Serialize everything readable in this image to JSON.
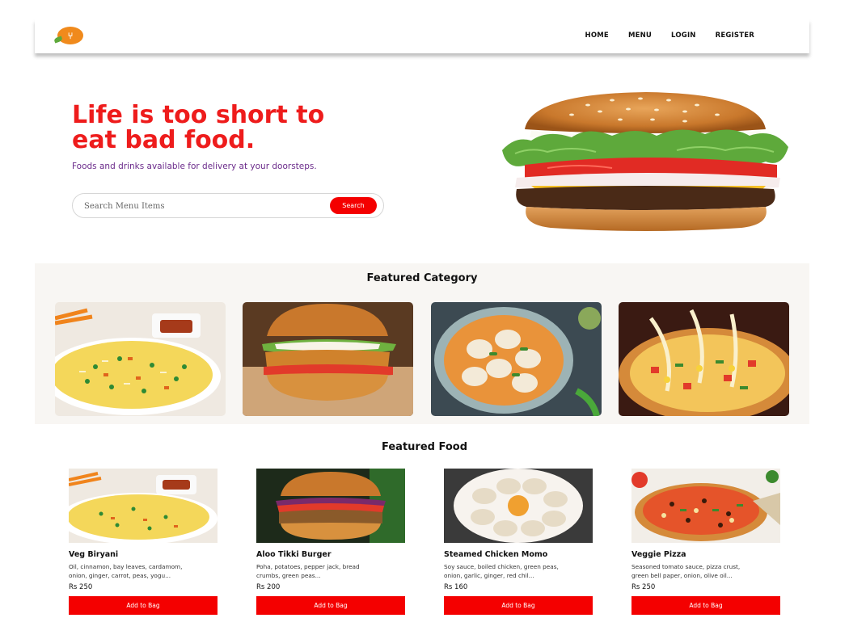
{
  "nav": {
    "items": [
      "HOME",
      "MENU",
      "LOGIN",
      "REGISTER"
    ]
  },
  "hero": {
    "title_line1": "Life is too short to",
    "title_line2": "eat bad food.",
    "subtitle": "Foods and drinks available for delivery at your doorsteps.",
    "search_placeholder": "Search Menu Items",
    "search_button": "Search"
  },
  "featured_category": {
    "title": "Featured Category",
    "items": [
      "biryani",
      "burger",
      "momo",
      "pizza"
    ]
  },
  "featured_food": {
    "title": "Featured Food",
    "items": [
      {
        "name": "Veg Biryani",
        "desc_line1": "Oil, cinnamon, bay leaves, cardamom,",
        "desc_line2": "onion, ginger, carrot, peas, yogu...",
        "price": "Rs 250",
        "button": "Add to Bag"
      },
      {
        "name": "Aloo Tikki Burger",
        "desc_line1": "Poha, potatoes, pepper jack, bread",
        "desc_line2": "crumbs, green peas...",
        "price": "Rs 200",
        "button": "Add to Bag"
      },
      {
        "name": "Steamed Chicken Momo",
        "desc_line1": "Soy sauce, boiled chicken, green peas,",
        "desc_line2": "onion, garlic, ginger, red chil...",
        "price": "Rs 160",
        "button": "Add to Bag"
      },
      {
        "name": "Veggie Pizza",
        "desc_line1": "Seasoned tomato sauce, pizza crust,",
        "desc_line2": "green bell paper, onion, olive oil...",
        "price": "Rs 250",
        "button": "Add to Bag"
      }
    ]
  },
  "colors": {
    "brand_red": "#ee1c1c",
    "button_red": "#f40000",
    "subtitle_purple": "#6a2a8a",
    "section_bg": "#f8f6f3",
    "logo_orange": "#f08a1c"
  },
  "icons": {
    "logo": "fork-knife-logo-icon"
  }
}
